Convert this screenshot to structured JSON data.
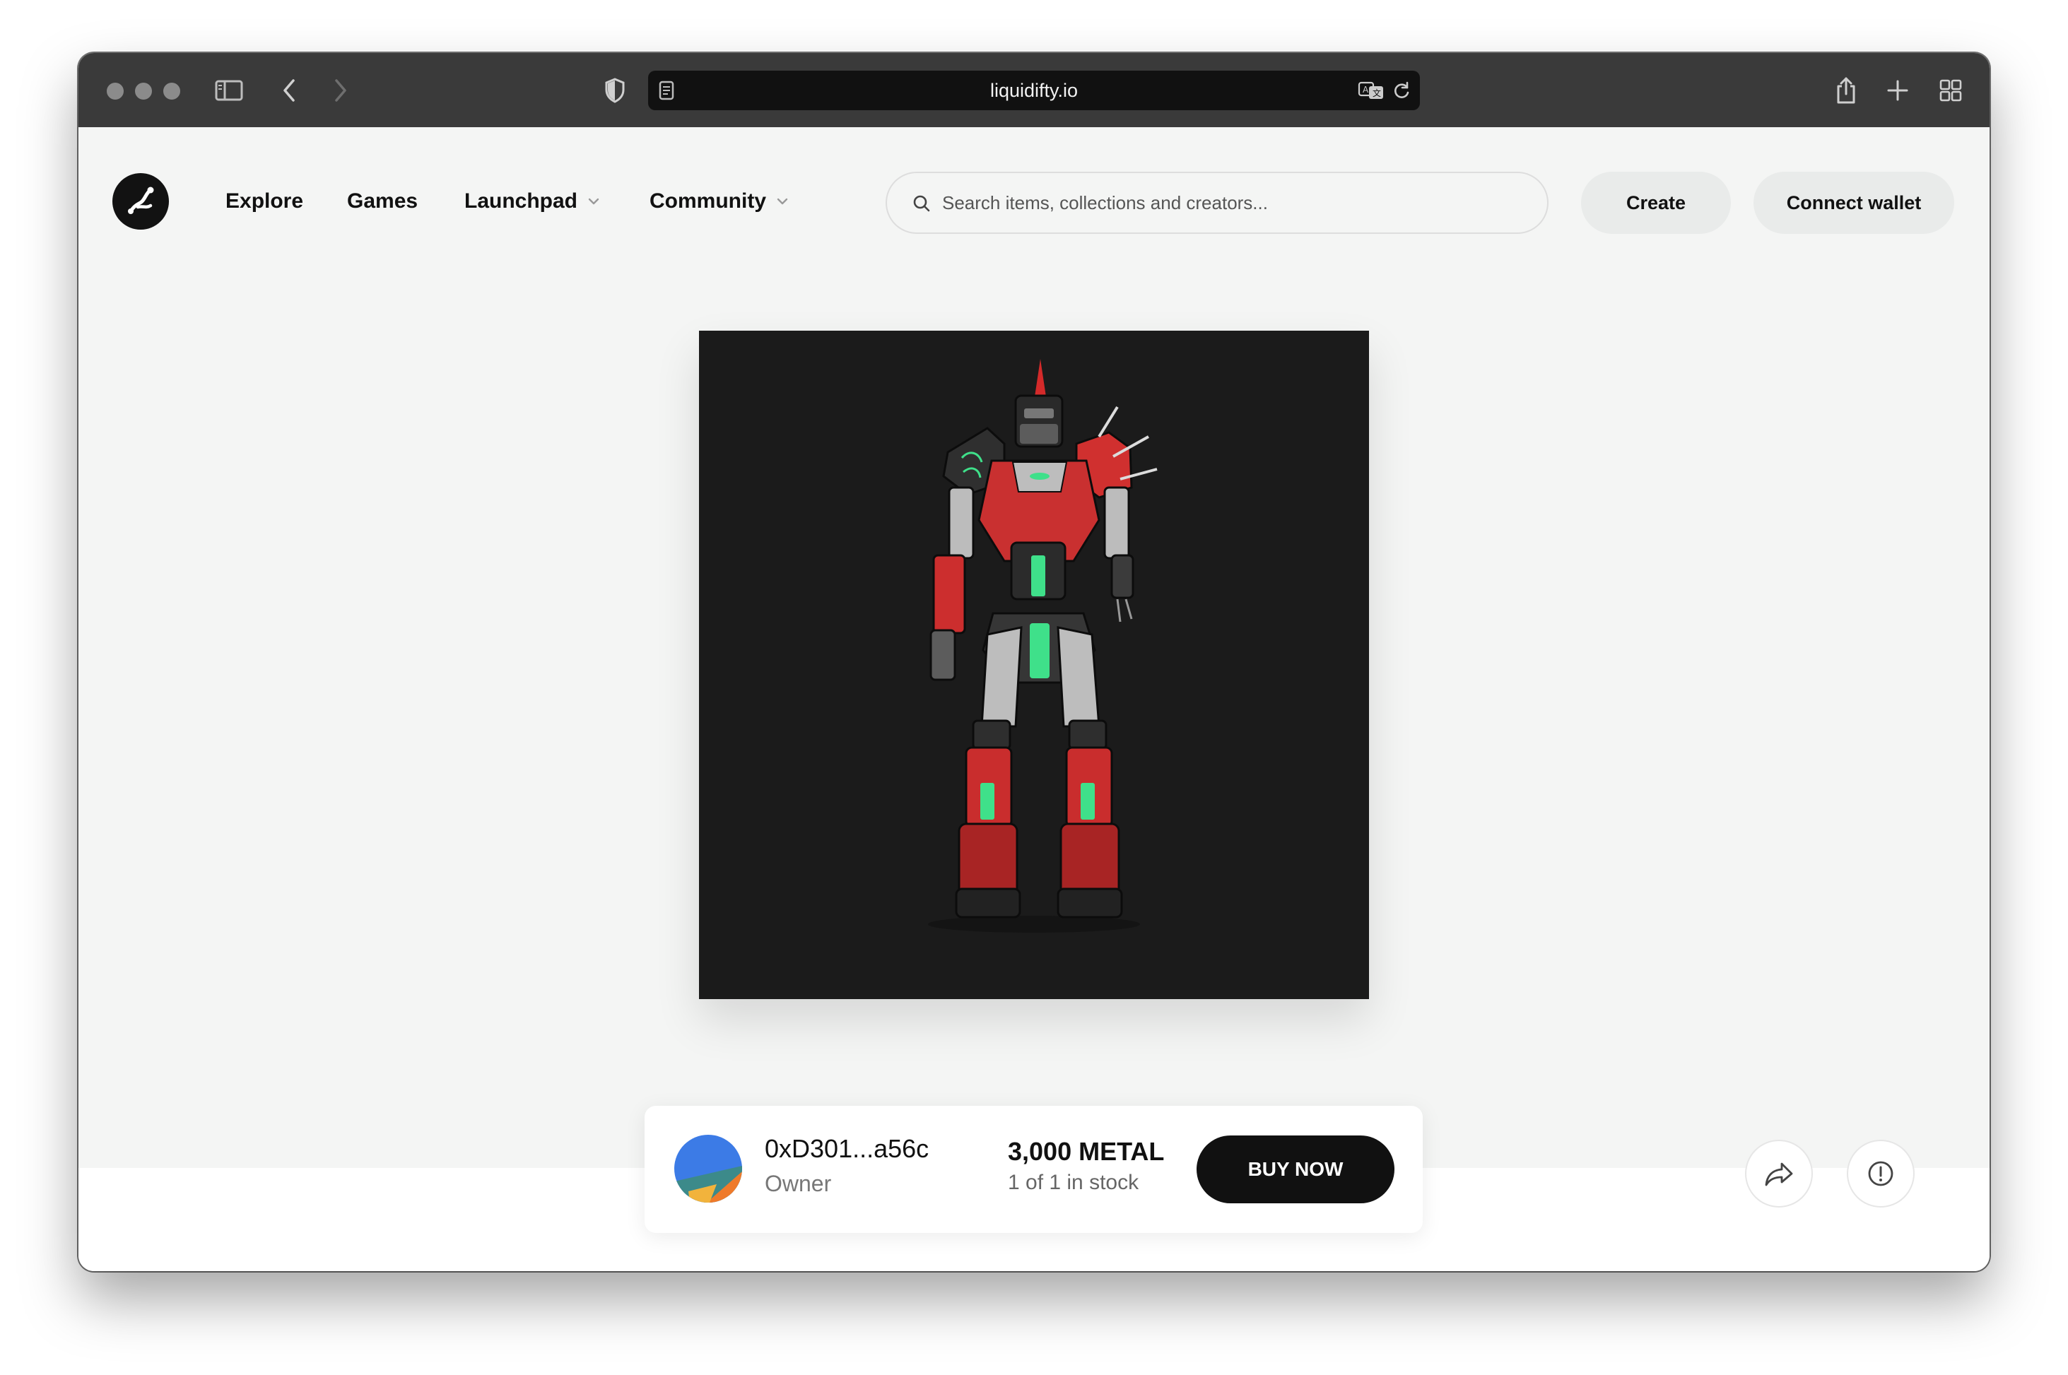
{
  "browser": {
    "url": "liquidifty.io"
  },
  "nav": {
    "items": [
      {
        "label": "Explore"
      },
      {
        "label": "Games"
      },
      {
        "label": "Launchpad"
      },
      {
        "label": "Community"
      }
    ]
  },
  "search": {
    "placeholder": "Search items, collections and creators..."
  },
  "actions": {
    "create_label": "Create",
    "connect_label": "Connect wallet"
  },
  "listing": {
    "owner_address": "0xD301...a56c",
    "owner_label": "Owner",
    "price": "3,000 METAL",
    "stock": "1 of 1 in stock",
    "buy_label": "BUY NOW"
  },
  "icons": {
    "share": "share-icon",
    "report": "alert-circle-icon"
  },
  "colors": {
    "chrome": "#3a3a3a",
    "page_bg": "#f4f5f4",
    "accent_dark": "#111111",
    "art_bg": "#1b1b1b",
    "avatar_blue": "#3c7be6",
    "avatar_orange": "#ef7a2a",
    "avatar_teal": "#3c8a8a",
    "avatar_yellow": "#f2b33c"
  }
}
